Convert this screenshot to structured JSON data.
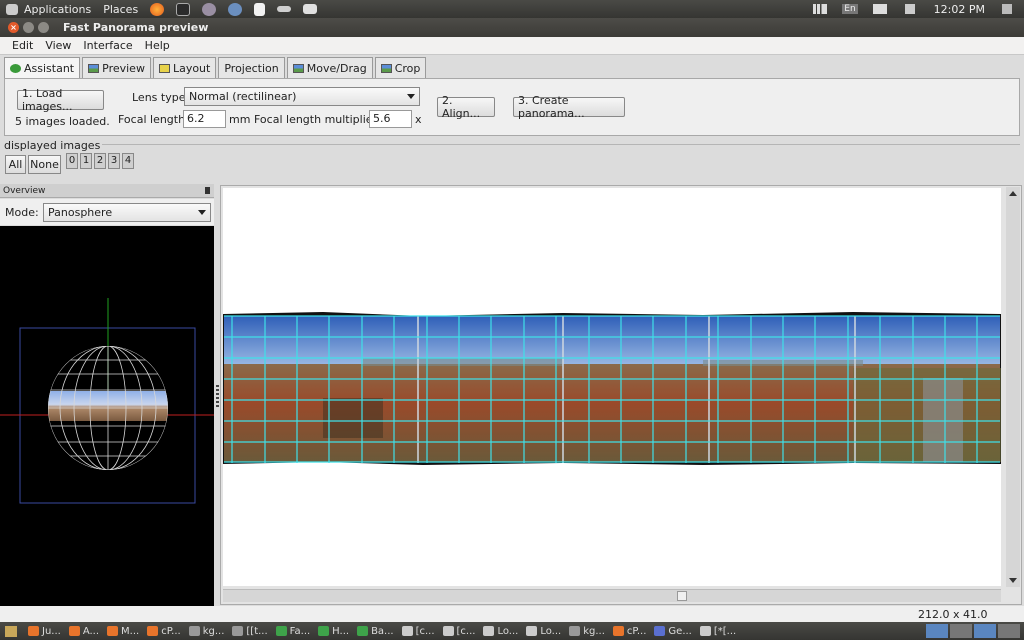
{
  "top_panel": {
    "applications": "Applications",
    "places": "Places",
    "time": "12:02 PM",
    "keyboard": "En"
  },
  "window": {
    "title": "Fast Panorama preview"
  },
  "menu": [
    "Edit",
    "View",
    "Interface",
    "Help"
  ],
  "tabs": [
    {
      "label": "Assistant",
      "icon": "assistant-icon",
      "active": true
    },
    {
      "label": "Preview",
      "icon": "preview-icon"
    },
    {
      "label": "Layout",
      "icon": "layout-icon"
    },
    {
      "label": "Projection"
    },
    {
      "label": "Move/Drag",
      "icon": "move-drag-icon"
    },
    {
      "label": "Crop",
      "icon": "crop-icon"
    }
  ],
  "assistant": {
    "load_button": "1. Load images...",
    "status": "5 images loaded.",
    "lens_type_label": "Lens type:",
    "lens_type_value": "Normal (rectilinear)",
    "focal_length_label": "Focal length:",
    "focal_length_value": "6.2",
    "focal_length_unit": "mm",
    "multiplier_label": "Focal length multiplier:",
    "multiplier_value": "5.6",
    "multiplier_unit": "x",
    "align_button": "2. Align...",
    "create_button": "3. Create panorama..."
  },
  "displayed_images": {
    "label": "displayed images",
    "all": "All",
    "none": "None",
    "images": [
      "0",
      "1",
      "2",
      "3",
      "4"
    ]
  },
  "overview": {
    "title": "Overview",
    "mode_label": "Mode:",
    "mode_value": "Panosphere"
  },
  "status": {
    "size": "212.0 x 41.0"
  },
  "taskbar": [
    {
      "label": "Ju...",
      "color": "#e8742b"
    },
    {
      "label": "A...",
      "color": "#e8742b"
    },
    {
      "label": "M...",
      "color": "#e8742b"
    },
    {
      "label": "cP...",
      "color": "#e8742b"
    },
    {
      "label": "kg...",
      "color": "#999999"
    },
    {
      "label": "[[t...",
      "color": "#999999"
    },
    {
      "label": "Fa...",
      "color": "#3ea34a"
    },
    {
      "label": "H...",
      "color": "#3ea34a"
    },
    {
      "label": "Ba...",
      "color": "#3ea34a"
    },
    {
      "label": "[c...",
      "color": "#cccccc"
    },
    {
      "label": "[c...",
      "color": "#cccccc"
    },
    {
      "label": "Lo...",
      "color": "#cccccc"
    },
    {
      "label": "Lo...",
      "color": "#cccccc"
    },
    {
      "label": "kg...",
      "color": "#999999"
    },
    {
      "label": "cP...",
      "color": "#e8742b"
    },
    {
      "label": "Ge...",
      "color": "#5a6fd0"
    },
    {
      "label": "[*[...",
      "color": "#cccccc"
    }
  ]
}
